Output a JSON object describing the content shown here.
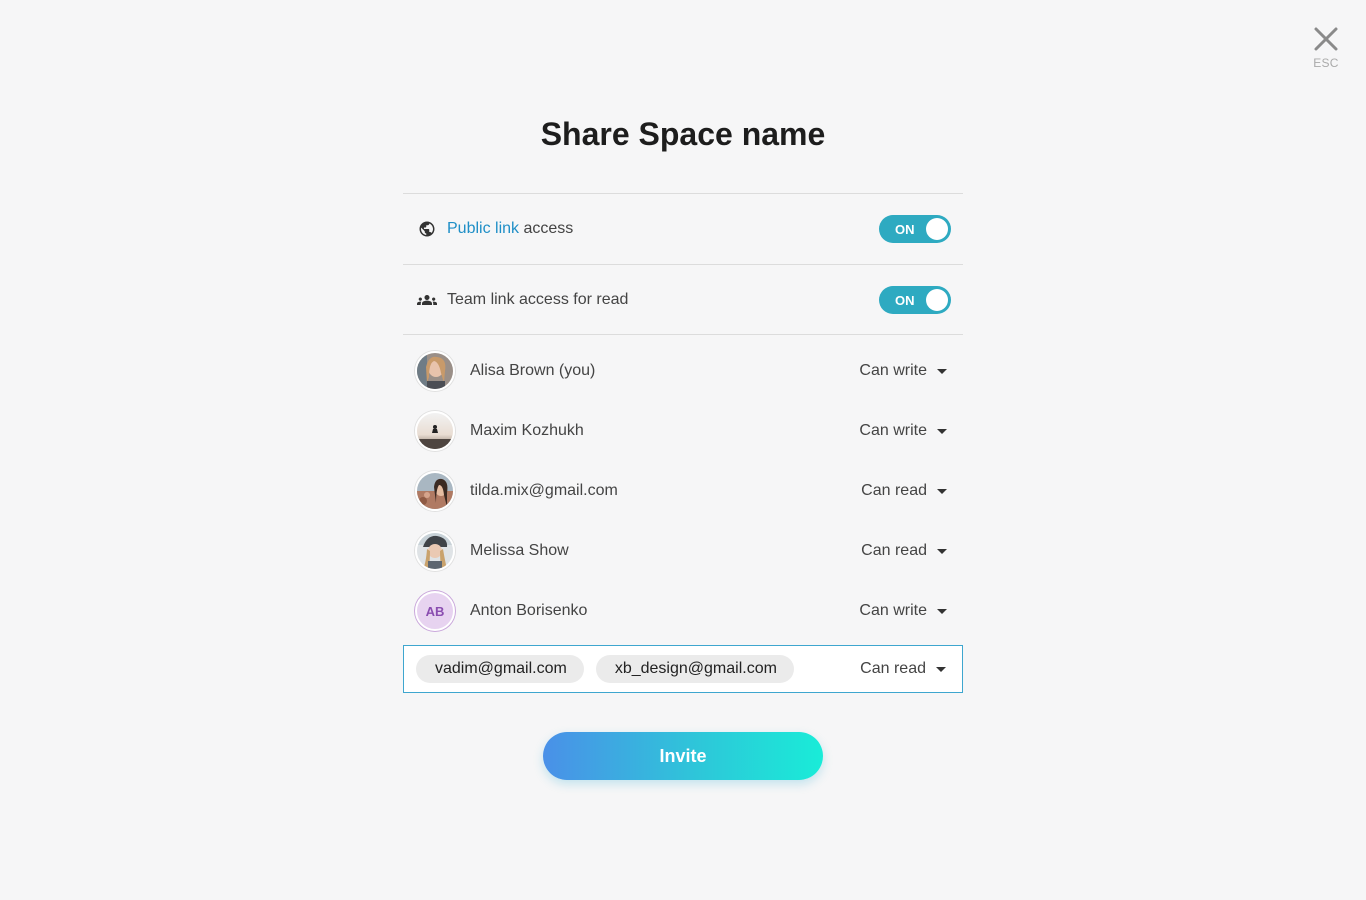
{
  "close": {
    "esc_label": "ESC"
  },
  "title": "Share Space name",
  "settings": [
    {
      "link_text": "Public link",
      "text": " access",
      "toggle": "ON",
      "icon": "globe-icon"
    },
    {
      "link_text": "",
      "text": "Team link access for read",
      "toggle": "ON",
      "icon": "team-icon"
    }
  ],
  "members": [
    {
      "name": "Alisa Brown (you)",
      "permission": "Can write",
      "avatar": "photo"
    },
    {
      "name": "Maxim Kozhukh",
      "permission": "Can write",
      "avatar": "photo"
    },
    {
      "name": "tilda.mix@gmail.com",
      "permission": "Can read",
      "avatar": "photo"
    },
    {
      "name": "Melissa Show",
      "permission": "Can read",
      "avatar": "photo"
    },
    {
      "name": "Anton Borisenko",
      "permission": "Can write",
      "avatar_initials": "AB"
    }
  ],
  "invite": {
    "chips": [
      "vadim@gmail.com",
      "xb_design@gmail.com"
    ],
    "permission": "Can read",
    "button_label": "Invite"
  },
  "colors": {
    "accent": "#2eaac1",
    "link": "#1f8fc7",
    "button_gradient_start": "#4a90e8",
    "button_gradient_end": "#19ecd8"
  }
}
